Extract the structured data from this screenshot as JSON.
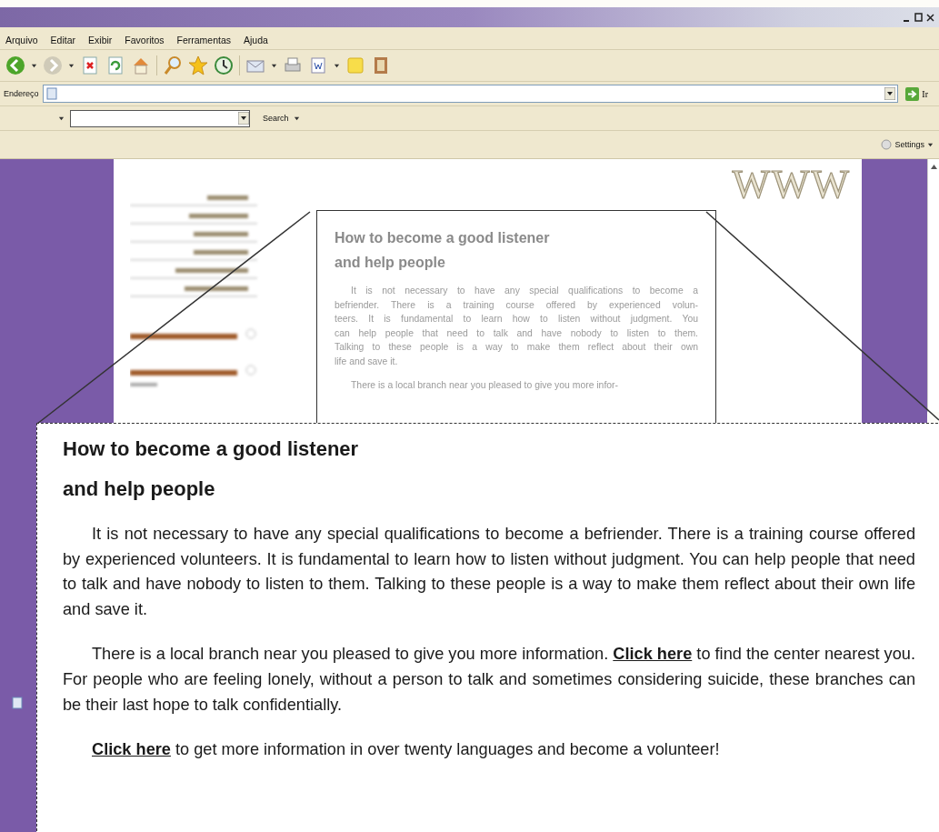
{
  "menu": [
    "Arquivo",
    "Editar",
    "Exibir",
    "Favoritos",
    "Ferramentas",
    "Ajuda"
  ],
  "address_bar": {
    "label": "Endereço",
    "go_label": "Ir"
  },
  "search_bar": {
    "button": "Search"
  },
  "links_bar": {
    "settings": "Settings"
  },
  "page": {
    "logo": "WWW",
    "article": {
      "title_lines": [
        "How to become a good listener",
        "and help people"
      ],
      "paragraphs": [
        {
          "lines": [
            "It is not necessary to have any special qualifications to become a",
            "befriender. There is a training course offered by experienced volun-",
            "teers. It is fundamental to learn how to listen without judgment. You",
            "can help people that need to talk and have nobody to listen to them.",
            "Talking to these people is a way to make them reflect about their own",
            "life and save it."
          ]
        },
        {
          "lines": [
            "There is a local branch near you pleased to give you more infor-"
          ]
        }
      ]
    }
  },
  "callout": {
    "title_lines": [
      "How to become a good listener",
      "and help people"
    ],
    "paragraphs": [
      {
        "parts": [
          {
            "kind": "text",
            "text": "It is not necessary to have any special qualifications to become a befriender. There is a training course offered by experienced volunteers. It is fundamental to learn how to listen without judgment. You can help people that need to talk and have nobody to listen to them. Talking to these people is a way to make them reflect about their own life and save it."
          }
        ]
      },
      {
        "parts": [
          {
            "kind": "text",
            "text": "There is a local branch near you pleased to give you more information. "
          },
          {
            "kind": "link",
            "text": "Click here"
          },
          {
            "kind": "text",
            "text": " to find the center nearest you. For people who are feeling lonely, without a person to talk and sometimes considering suicide, these branches can be their last hope to talk confidentially."
          }
        ]
      },
      {
        "parts": [
          {
            "kind": "link",
            "text": "Click here"
          },
          {
            "kind": "text",
            "text": " to get more information in over twenty languages and become a volunteer!"
          }
        ]
      }
    ]
  }
}
